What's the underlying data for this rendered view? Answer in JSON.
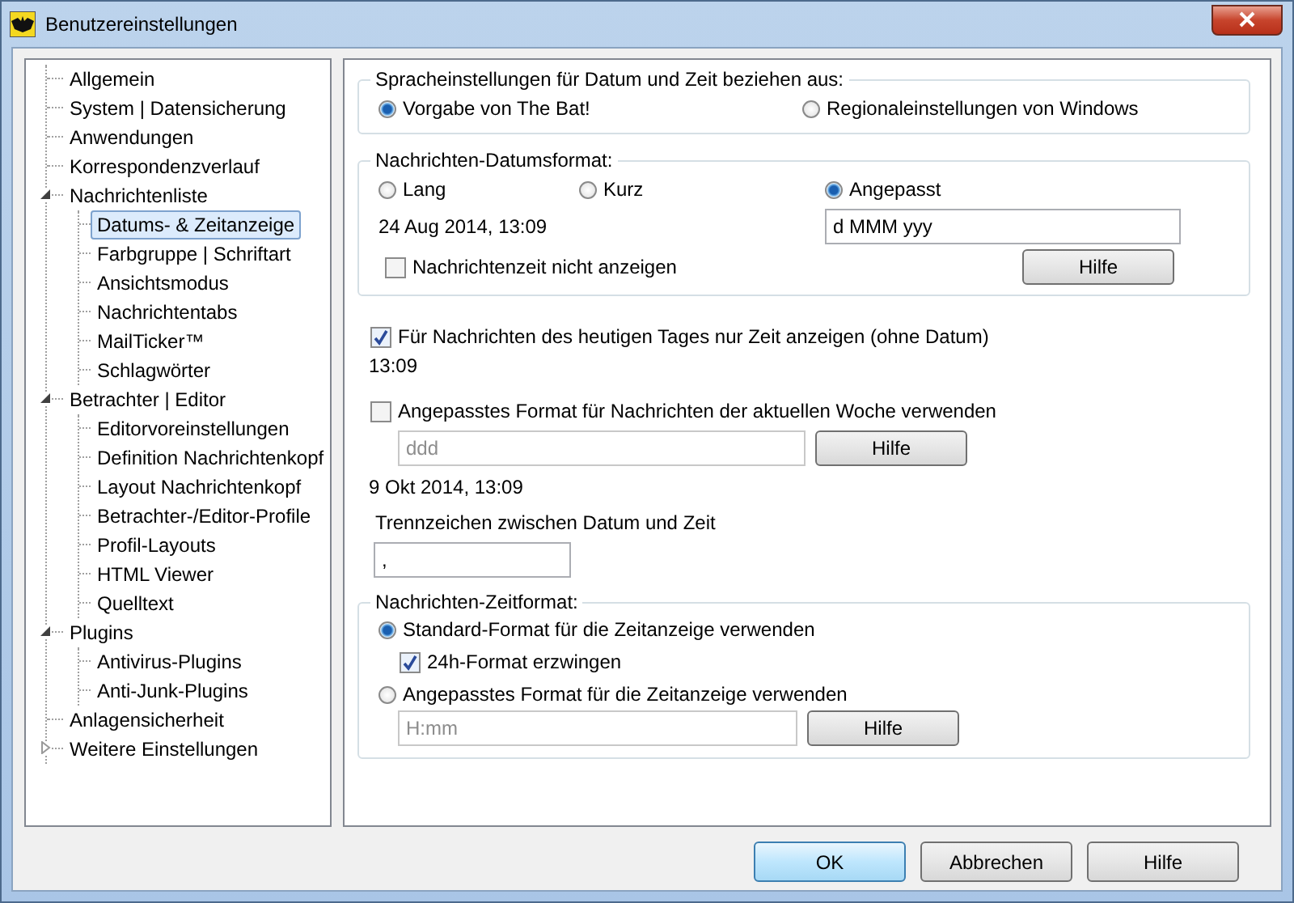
{
  "window": {
    "title": "Benutzereinstellungen"
  },
  "tree": [
    {
      "label": "Allgemein",
      "selected": false
    },
    {
      "label": "System | Datensicherung",
      "selected": false
    },
    {
      "label": "Anwendungen",
      "selected": false
    },
    {
      "label": "Korrespondenzverlauf",
      "selected": false
    },
    {
      "label": "Nachrichtenliste",
      "selected": false,
      "expanded": true,
      "children": [
        {
          "label": "Datums- & Zeitanzeige",
          "selected": true
        },
        {
          "label": "Farbgruppe | Schriftart",
          "selected": false
        },
        {
          "label": "Ansichtsmodus",
          "selected": false
        },
        {
          "label": "Nachrichtentabs",
          "selected": false
        },
        {
          "label": "MailTicker™",
          "selected": false
        },
        {
          "label": "Schlagwörter",
          "selected": false
        }
      ]
    },
    {
      "label": "Betrachter | Editor",
      "selected": false,
      "expanded": true,
      "children": [
        {
          "label": "Editorvoreinstellungen",
          "selected": false
        },
        {
          "label": "Definition Nachrichtenkopf",
          "selected": false
        },
        {
          "label": "Layout Nachrichtenkopf",
          "selected": false
        },
        {
          "label": "Betrachter-/Editor-Profile",
          "selected": false
        },
        {
          "label": "Profil-Layouts",
          "selected": false
        },
        {
          "label": "HTML Viewer",
          "selected": false
        },
        {
          "label": "Quelltext",
          "selected": false
        }
      ]
    },
    {
      "label": "Plugins",
      "selected": false,
      "expanded": true,
      "children": [
        {
          "label": "Antivirus-Plugins",
          "selected": false
        },
        {
          "label": "Anti-Junk-Plugins",
          "selected": false
        }
      ]
    },
    {
      "label": "Anlagensicherheit",
      "selected": false
    },
    {
      "label": "Weitere Einstellungen",
      "selected": false,
      "expanded": false
    }
  ],
  "date_source": {
    "legend": "Spracheinstellungen für Datum und Zeit beziehen aus:",
    "options": [
      {
        "label": "Vorgabe von The Bat!",
        "selected": true
      },
      {
        "label": "Regionaleinstellungen von Windows",
        "selected": false
      }
    ]
  },
  "date_format": {
    "legend": "Nachrichten-Datumsformat:",
    "options": [
      {
        "label": "Lang",
        "selected": false
      },
      {
        "label": "Kurz",
        "selected": false
      },
      {
        "label": "Angepasst",
        "selected": true
      }
    ],
    "preview": "24 Aug 2014, 13:09",
    "custom_format": {
      "value": "d MMM yyy"
    },
    "hide_time": {
      "label": "Nachrichtenzeit nicht anzeigen",
      "checked": false
    },
    "help_button": "Hilfe"
  },
  "today_only": {
    "label": "Für Nachrichten des heutigen Tages nur Zeit anzeigen (ohne Datum)",
    "checked": true
  },
  "today_preview": "13:09",
  "week_format": {
    "label": "Angepasstes Format für Nachrichten der aktuellen Woche verwenden",
    "checked": false,
    "field": {
      "value": "ddd",
      "disabled": true
    },
    "help_button": "Hilfe"
  },
  "week_preview": "9 Okt 2014, 13:09",
  "separator": {
    "label": "Trennzeichen zwischen Datum und Zeit",
    "value": ","
  },
  "time_format": {
    "legend": "Nachrichten-Zeitformat:",
    "standard": {
      "label": "Standard-Format für die Zeitanzeige verwenden",
      "selected": true
    },
    "force_24h": {
      "label": "24h-Format erzwingen",
      "checked": true
    },
    "custom": {
      "label": "Angepasstes Format für die Zeitanzeige verwenden",
      "selected": false
    },
    "field": {
      "value": "H:mm",
      "disabled": true
    },
    "help_button": "Hilfe"
  },
  "buttons": [
    {
      "label": "OK",
      "default": true
    },
    {
      "label": "Abbrechen",
      "default": false
    },
    {
      "label": "Hilfe",
      "default": false
    }
  ]
}
